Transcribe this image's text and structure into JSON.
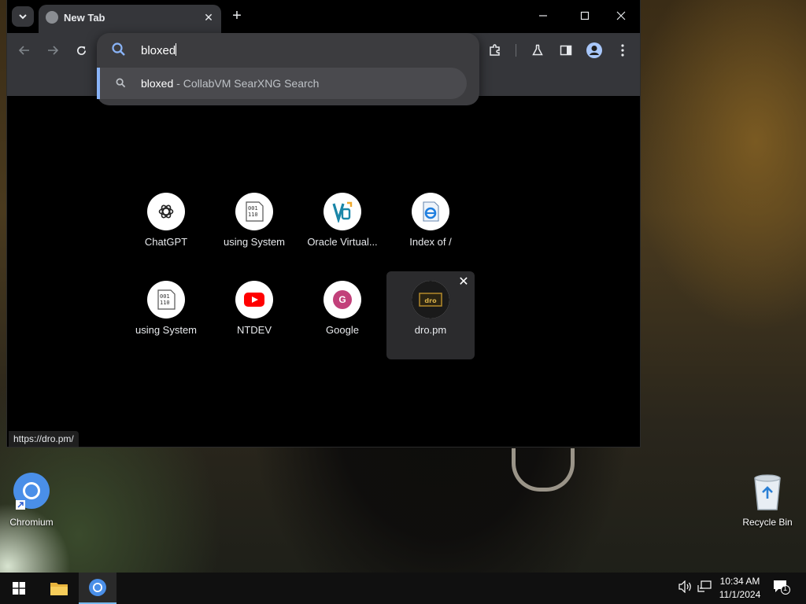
{
  "browser": {
    "tab": {
      "title": "New Tab"
    },
    "omnibox": {
      "query": "bloxed",
      "suggestion": {
        "text": "bloxed",
        "description": " - CollabVM SearXNG Search"
      }
    },
    "shortcuts": [
      {
        "label": "ChatGPT",
        "icon": "chatgpt-icon"
      },
      {
        "label": "using System",
        "icon": "binary-doc-icon"
      },
      {
        "label": "Oracle Virtual...",
        "icon": "virtualbox-icon"
      },
      {
        "label": "Index of /",
        "icon": "ie-page-icon"
      },
      {
        "label": "using System",
        "icon": "binary-doc-icon"
      },
      {
        "label": "NTDEV",
        "icon": "youtube-icon"
      },
      {
        "label": "Google",
        "icon": "letter-g-icon",
        "icon_letter": "G",
        "icon_color": "#c2407a"
      },
      {
        "label": "dro.pm",
        "icon": "dro-pm-icon",
        "hovered": true
      }
    ],
    "status_url": "https://dro.pm/"
  },
  "desktop": {
    "icons": [
      {
        "label": "Chromium",
        "icon": "chromium-icon"
      },
      {
        "label": "Recycle Bin",
        "icon": "recycle-bin-icon"
      }
    ]
  },
  "taskbar": {
    "clock": {
      "time": "10:34 AM",
      "date": "11/1/2024"
    },
    "notification_count": "1"
  },
  "colors": {
    "accent": "#8ab4f8",
    "toolbar": "#35363a",
    "taskbar_highlight": "#76b9ed"
  }
}
